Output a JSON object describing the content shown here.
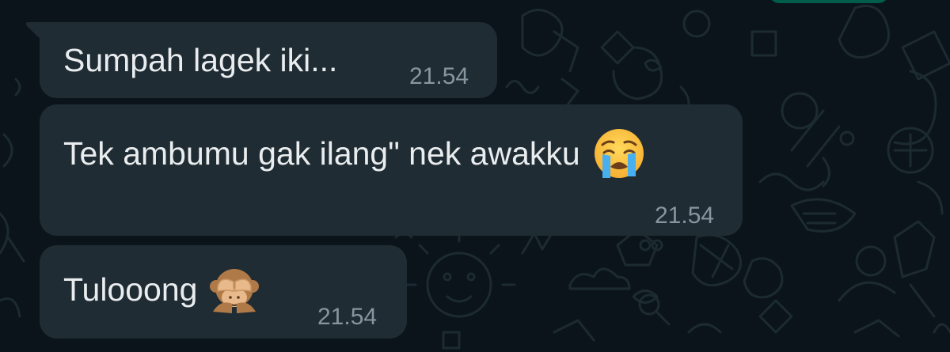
{
  "chat": {
    "messages": [
      {
        "text": "Sumpah lagek iki...",
        "time": "21.54",
        "emoji": ""
      },
      {
        "text": "Tek ambumu gak ilang\" nek awakku",
        "time": "21.54",
        "emoji": "crying-face-emoji"
      },
      {
        "text": "Tulooong",
        "time": "21.54",
        "emoji": "see-no-evil-monkey-emoji"
      }
    ]
  },
  "colors": {
    "background": "#0b141a",
    "incoming_bubble": "#202c33",
    "message_text": "#e9edef",
    "timestamp_text": "#8696a0",
    "outgoing_bubble": "#005c4b"
  }
}
